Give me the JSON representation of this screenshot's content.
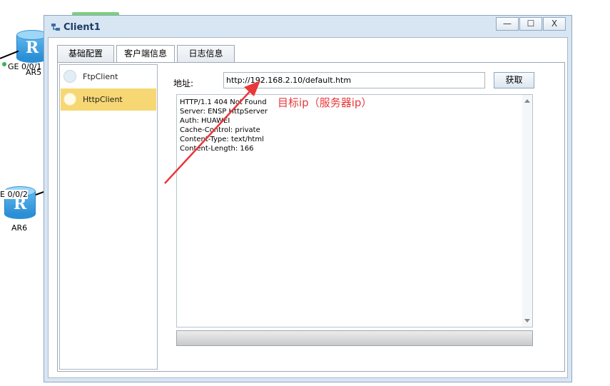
{
  "topology": {
    "routers": [
      {
        "name": "AR5",
        "port": "GE 0/0/1"
      },
      {
        "name": "AR6",
        "port": "E 0/0/2"
      }
    ]
  },
  "window": {
    "title": "Client1",
    "controls": {
      "minimize": "—",
      "maximize": "☐",
      "close": "X"
    }
  },
  "tabs": [
    "基础配置",
    "客户端信息",
    "日志信息"
  ],
  "active_tab": "客户端信息",
  "client_list": {
    "items": [
      {
        "label": "FtpClient",
        "selected": false
      },
      {
        "label": "HttpClient",
        "selected": true
      }
    ]
  },
  "http": {
    "address_label": "地址:",
    "address_value": "http://192.168.2.10/default.htm",
    "fetch_label": "获取",
    "response_lines": [
      "HTTP/1.1 404 Not Found",
      "Server: ENSP HttpServer",
      "Auth: HUAWEI",
      "Cache-Control: private",
      "Content-Type: text/html",
      "Content-Length: 166"
    ]
  },
  "annotation": {
    "text": "目标ip（服务器ip）",
    "color": "#e8383a"
  }
}
